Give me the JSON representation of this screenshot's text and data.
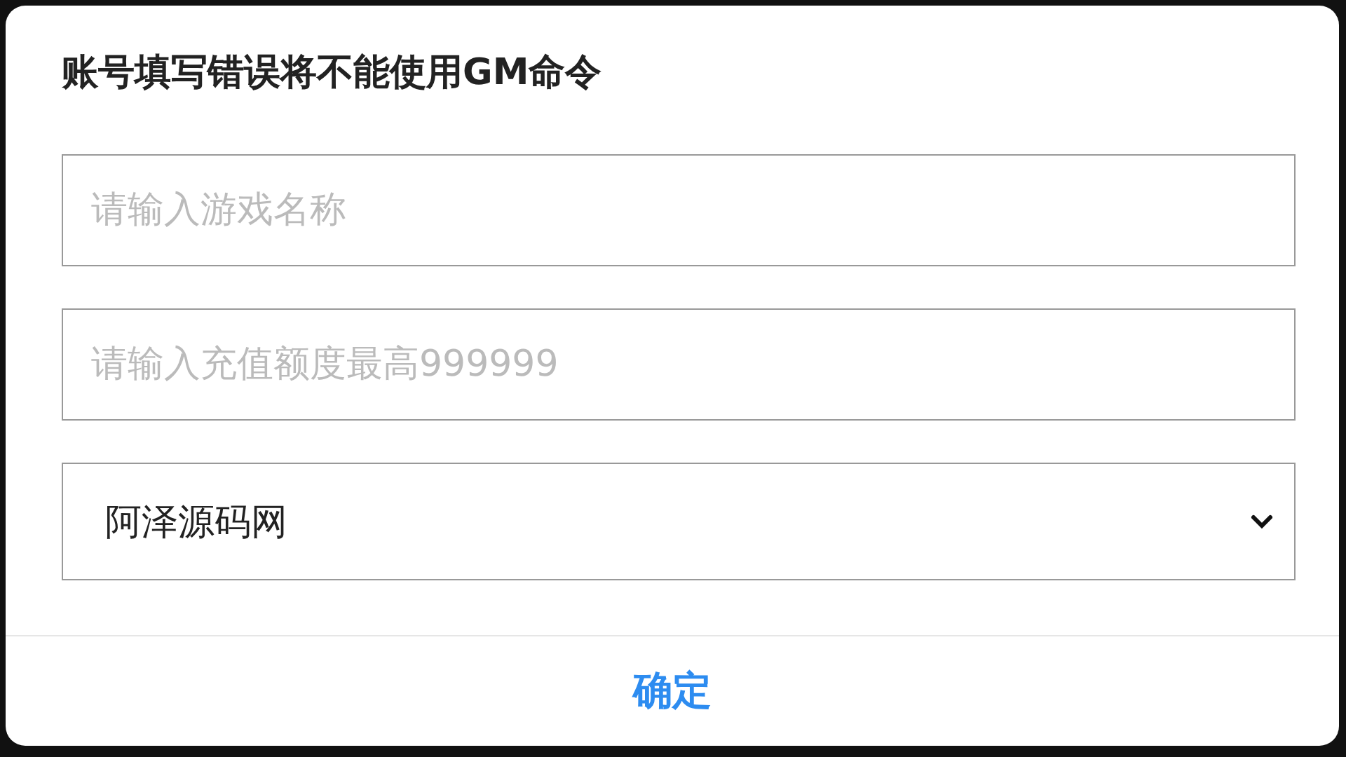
{
  "dialog": {
    "title": "账号填写错误将不能使用GM命令",
    "fields": [
      {
        "kind": "input",
        "placeholder": "请输入游戏名称"
      },
      {
        "kind": "input",
        "placeholder": "请输入充值额度最高999999"
      },
      {
        "kind": "select",
        "value": "阿泽源码网"
      }
    ],
    "confirm_button": "确定"
  }
}
